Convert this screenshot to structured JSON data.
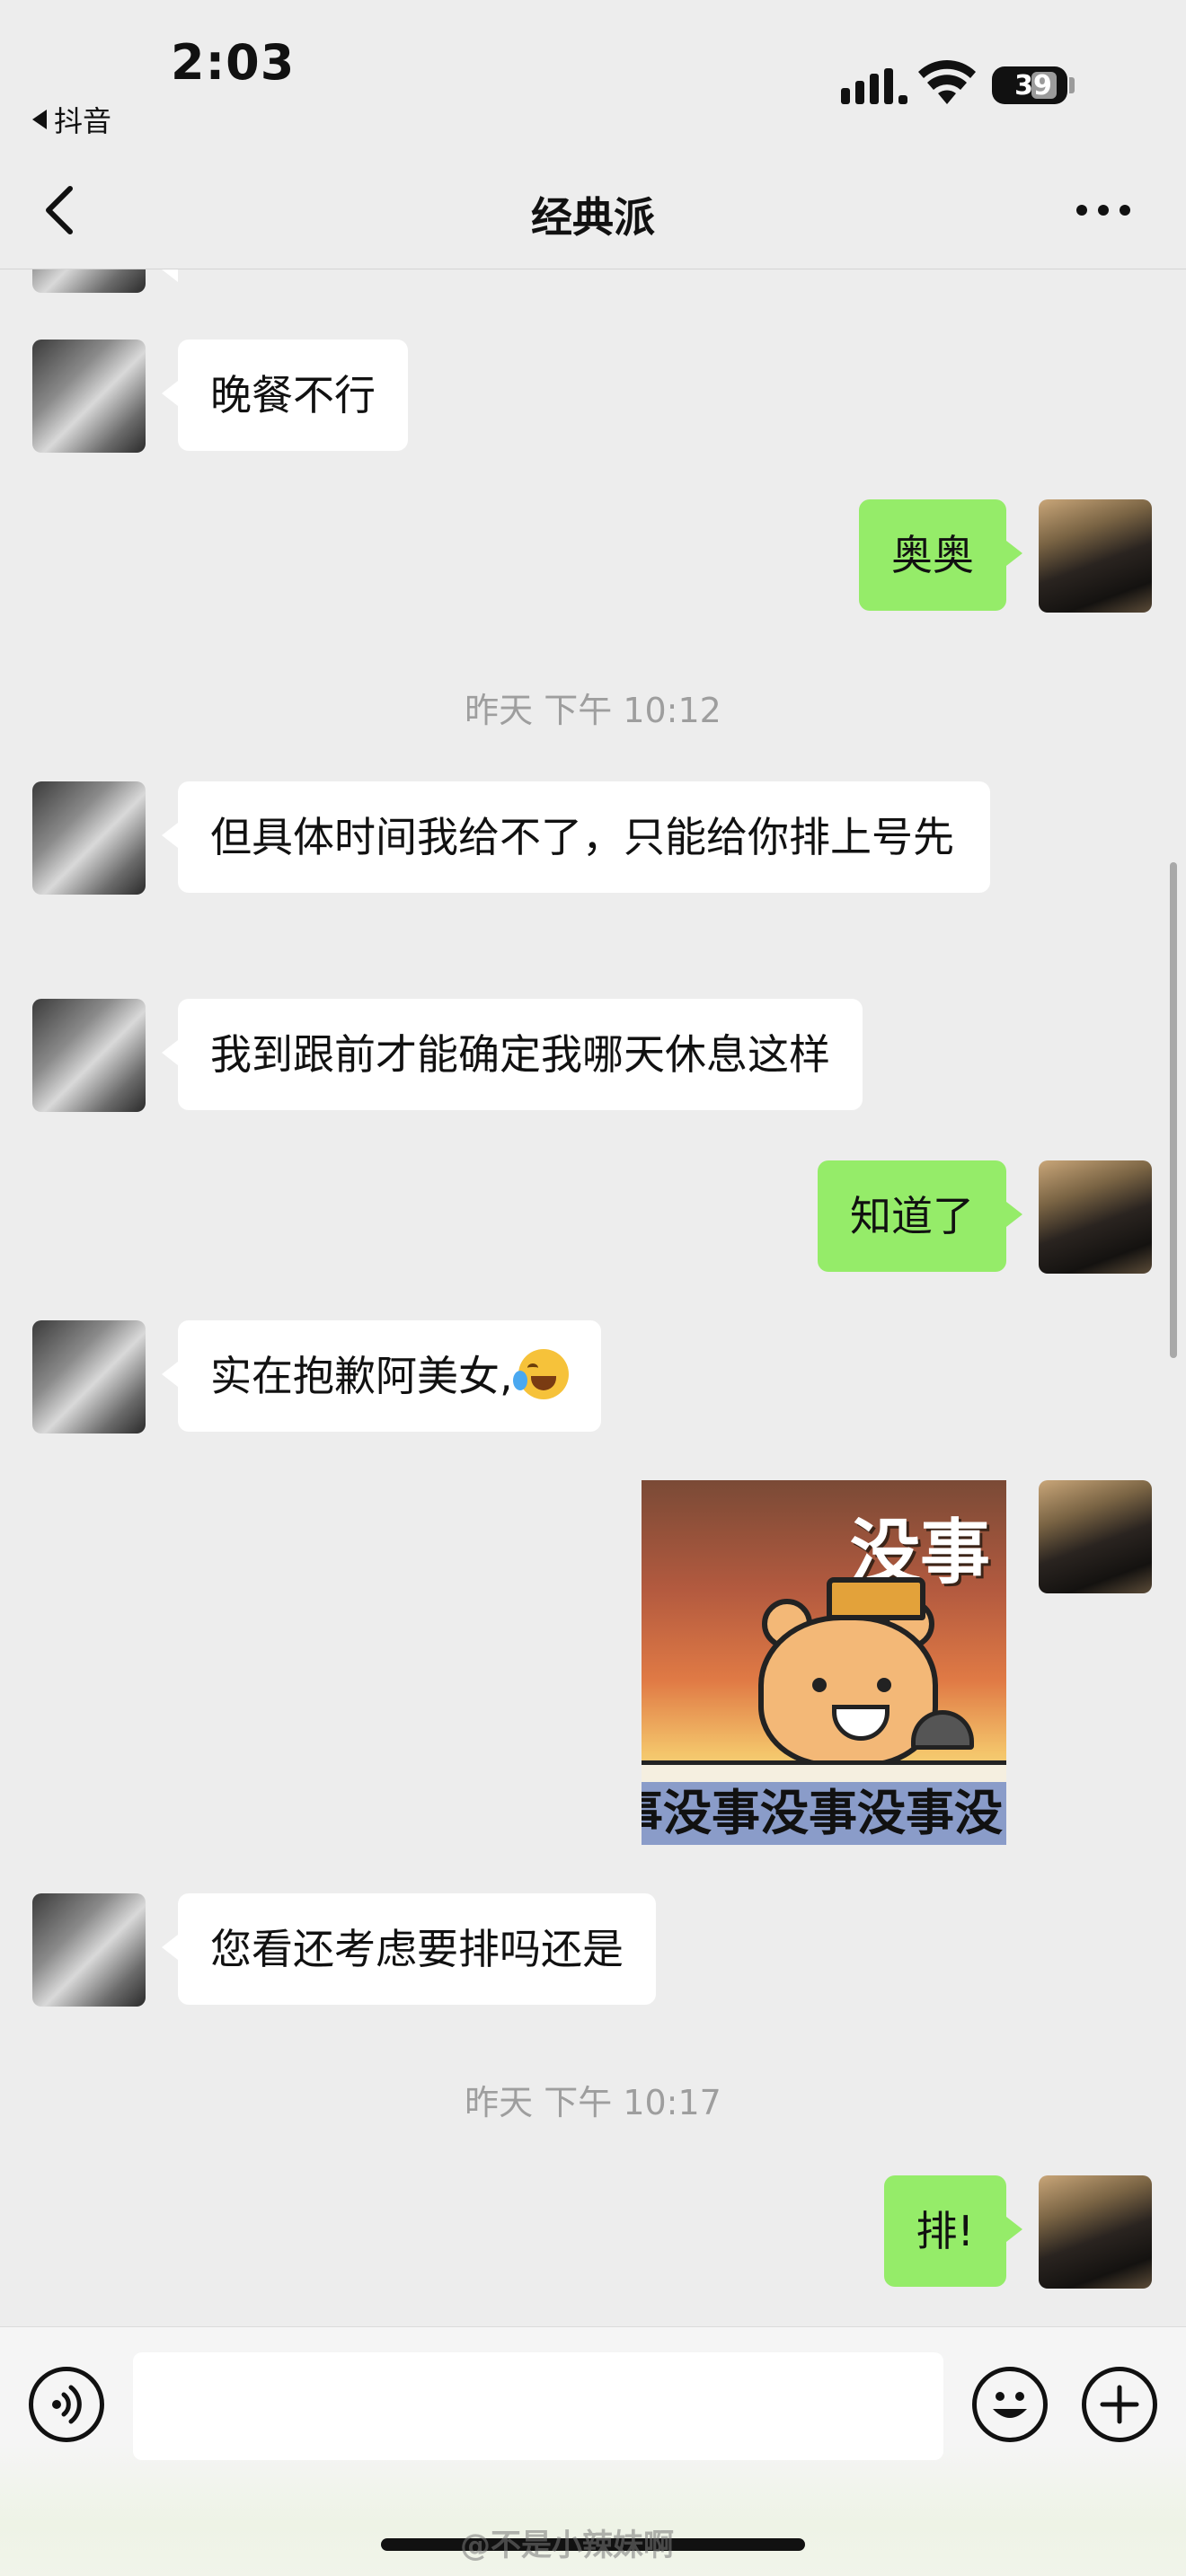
{
  "status_bar": {
    "time": "2:03",
    "back_app": "抖音",
    "battery": "39"
  },
  "nav": {
    "title": "经典派"
  },
  "messages": [
    {
      "text": "晚餐不行"
    },
    {
      "text": "奥奥"
    },
    {
      "text": "昨天 下午 10:12"
    },
    {
      "text": "但具体时间我给不了，只能给你排上号先"
    },
    {
      "text": "我到跟前才能确定我哪天休息这样"
    },
    {
      "text": "知道了"
    },
    {
      "text": "实在抱歉阿美女,"
    },
    {
      "text": "您看还考虑要排吗还是"
    },
    {
      "text": "昨天 下午 10:17"
    },
    {
      "text": "排!"
    }
  ],
  "sticker": {
    "title": "没事",
    "banner": "事没事没事没事没"
  },
  "input_bar": {
    "text_value": ""
  },
  "watermark": "@不是小辣妹啊"
}
